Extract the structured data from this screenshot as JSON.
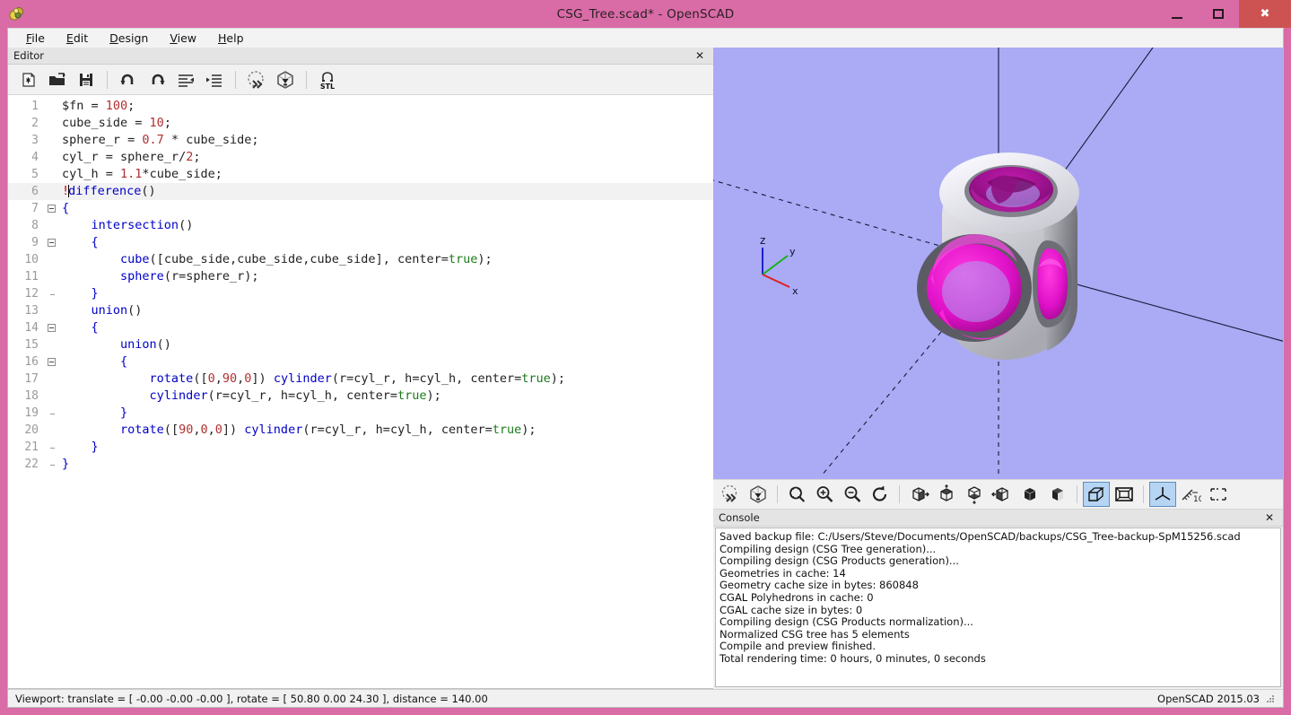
{
  "window": {
    "title": "CSG_Tree.scad* - OpenSCAD",
    "app_icon": "openscad-logo-icon",
    "frame_color": "#d96ba6",
    "minimize_label": "Minimize",
    "maximize_label": "Maximize",
    "close_label": "Close"
  },
  "menubar": {
    "items": [
      {
        "label": "File",
        "mnemonic": "F"
      },
      {
        "label": "Edit",
        "mnemonic": "E"
      },
      {
        "label": "Design",
        "mnemonic": "D"
      },
      {
        "label": "View",
        "mnemonic": "V"
      },
      {
        "label": "Help",
        "mnemonic": "H"
      }
    ]
  },
  "editor_dock": {
    "title": "Editor",
    "close_label": "✕",
    "toolbar": [
      {
        "name": "new-file-icon",
        "tooltip": "New"
      },
      {
        "name": "open-file-icon",
        "tooltip": "Open"
      },
      {
        "name": "save-file-icon",
        "tooltip": "Save"
      },
      {
        "name": "undo-icon",
        "tooltip": "Undo"
      },
      {
        "name": "redo-icon",
        "tooltip": "Redo"
      },
      {
        "name": "unindent-icon",
        "tooltip": "Unindent"
      },
      {
        "name": "indent-icon",
        "tooltip": "Indent"
      },
      {
        "name": "preview-icon",
        "tooltip": "Preview"
      },
      {
        "name": "render-icon",
        "tooltip": "Render"
      },
      {
        "name": "export-stl-icon",
        "tooltip": "Export as STL"
      }
    ]
  },
  "code": {
    "current_line": 6,
    "colors": {
      "keyword": "#0000c8",
      "number": "#b03030",
      "boolean": "#1a7a1a",
      "plain": "#222222",
      "root_modifier": "#cc0000",
      "gutter": "#9a9a9a"
    },
    "lines": [
      {
        "n": 1,
        "text": "$fn = 100;"
      },
      {
        "n": 2,
        "text": "cube_side = 10;"
      },
      {
        "n": 3,
        "text": "sphere_r = 0.7 * cube_side;"
      },
      {
        "n": 4,
        "text": "cyl_r = sphere_r/2;"
      },
      {
        "n": 5,
        "text": "cyl_h = 1.1*cube_side;"
      },
      {
        "n": 6,
        "text": "!difference()"
      },
      {
        "n": 7,
        "text": "{"
      },
      {
        "n": 8,
        "text": "    intersection()"
      },
      {
        "n": 9,
        "text": "    {"
      },
      {
        "n": 10,
        "text": "        cube([cube_side,cube_side,cube_side], center=true);"
      },
      {
        "n": 11,
        "text": "        sphere(r=sphere_r);"
      },
      {
        "n": 12,
        "text": "    }"
      },
      {
        "n": 13,
        "text": "    union()"
      },
      {
        "n": 14,
        "text": "    {"
      },
      {
        "n": 15,
        "text": "        union()"
      },
      {
        "n": 16,
        "text": "        {"
      },
      {
        "n": 17,
        "text": "            rotate([0,90,0]) cylinder(r=cyl_r, h=cyl_h, center=true);"
      },
      {
        "n": 18,
        "text": "            cylinder(r=cyl_r, h=cyl_h, center=true);"
      },
      {
        "n": 19,
        "text": "        }"
      },
      {
        "n": 20,
        "text": "        rotate([90,0,0]) cylinder(r=cyl_r, h=cyl_h, center=true);"
      },
      {
        "n": 21,
        "text": "    }"
      },
      {
        "n": 22,
        "text": "}"
      }
    ]
  },
  "viewport": {
    "background_color": "#aaaaf5",
    "model_description": "rounded cube with three cylindrical through-holes, magenta highlighted interior",
    "axis_labels": {
      "x": "x",
      "y": "y",
      "z": "z"
    },
    "axis_colors": {
      "x": "#e02020",
      "y": "#18b018",
      "z": "#2020d0"
    }
  },
  "view_toolbar": {
    "buttons": [
      {
        "name": "preview-icon",
        "tooltip": "Preview",
        "active": false
      },
      {
        "name": "render-icon",
        "tooltip": "Render",
        "active": false
      },
      {
        "name": "zoom-all-icon",
        "tooltip": "View All",
        "active": false
      },
      {
        "name": "zoom-in-icon",
        "tooltip": "Zoom In",
        "active": false
      },
      {
        "name": "zoom-out-icon",
        "tooltip": "Zoom Out",
        "active": false
      },
      {
        "name": "reset-view-icon",
        "tooltip": "Reset View",
        "active": false
      },
      {
        "name": "view-right-icon",
        "tooltip": "Right View",
        "active": false
      },
      {
        "name": "view-top-icon",
        "tooltip": "Top View",
        "active": false
      },
      {
        "name": "view-bottom-icon",
        "tooltip": "Bottom View",
        "active": false
      },
      {
        "name": "view-left-icon",
        "tooltip": "Left View",
        "active": false
      },
      {
        "name": "view-front-icon",
        "tooltip": "Front View",
        "active": false
      },
      {
        "name": "view-back-icon",
        "tooltip": "Back View",
        "active": false
      },
      {
        "name": "perspective-icon",
        "tooltip": "Perspective",
        "active": true
      },
      {
        "name": "orthogonal-icon",
        "tooltip": "Orthogonal",
        "active": false
      },
      {
        "name": "show-axes-icon",
        "tooltip": "Show Axes",
        "active": true
      },
      {
        "name": "show-scale-markers-icon",
        "tooltip": "Show Scale Markers",
        "active": false
      },
      {
        "name": "show-edges-icon",
        "tooltip": "Show Edges",
        "active": false
      }
    ]
  },
  "console": {
    "title": "Console",
    "close_label": "✕",
    "lines": [
      "Saved backup file: C:/Users/Steve/Documents/OpenSCAD/backups/CSG_Tree-backup-SpM15256.scad",
      "Compiling design (CSG Tree generation)...",
      "Compiling design (CSG Products generation)...",
      "Geometries in cache: 14",
      "Geometry cache size in bytes: 860848",
      "CGAL Polyhedrons in cache: 0",
      "CGAL cache size in bytes: 0",
      "Compiling design (CSG Products normalization)...",
      "Normalized CSG tree has 5 elements",
      "Compile and preview finished.",
      "Total rendering time: 0 hours, 0 minutes, 0 seconds"
    ]
  },
  "statusbar": {
    "viewport_info": "Viewport: translate = [ -0.00 -0.00 -0.00 ], rotate = [ 50.80 0.00 24.30 ], distance = 140.00",
    "version": "OpenSCAD 2015.03"
  }
}
